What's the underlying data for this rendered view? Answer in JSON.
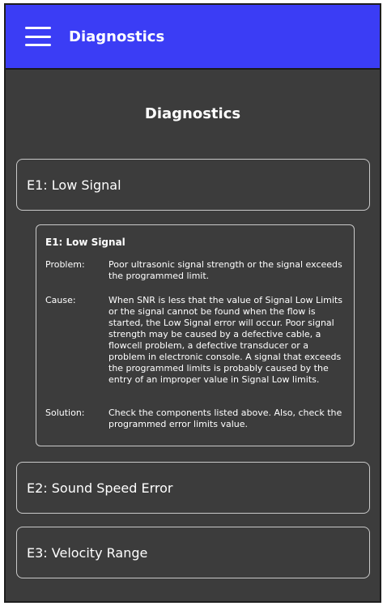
{
  "header": {
    "title": "Diagnostics",
    "menu_icon": "hamburger-menu-icon",
    "bar_color": "#3b3df5"
  },
  "page": {
    "title": "Diagnostics",
    "background": "#3c3c3c"
  },
  "errors": [
    {
      "label": "E1: Low Signal"
    },
    {
      "label": "E2: Sound Speed Error"
    },
    {
      "label": "E3: Velocity Range"
    }
  ],
  "detail": {
    "title": "E1: Low Signal",
    "rows": [
      {
        "label": "Problem:",
        "value": "Poor ultrasonic signal strength or the signal exceeds the programmed limit."
      },
      {
        "label": "Cause:",
        "value": "When SNR is less that the value of Signal Low Limits or the signal cannot be found when the flow is started, the Low Signal error will occur. Poor signal strength may be caused by a defective cable, a flowcell problem, a defective transducer or a problem in electronic console. A signal that exceeds the programmed limits is probably caused by the entry of an improper value in Signal Low limits."
      },
      {
        "label": "Solution:",
        "value": "Check the components listed above. Also, check the programmed error limits value."
      }
    ]
  }
}
